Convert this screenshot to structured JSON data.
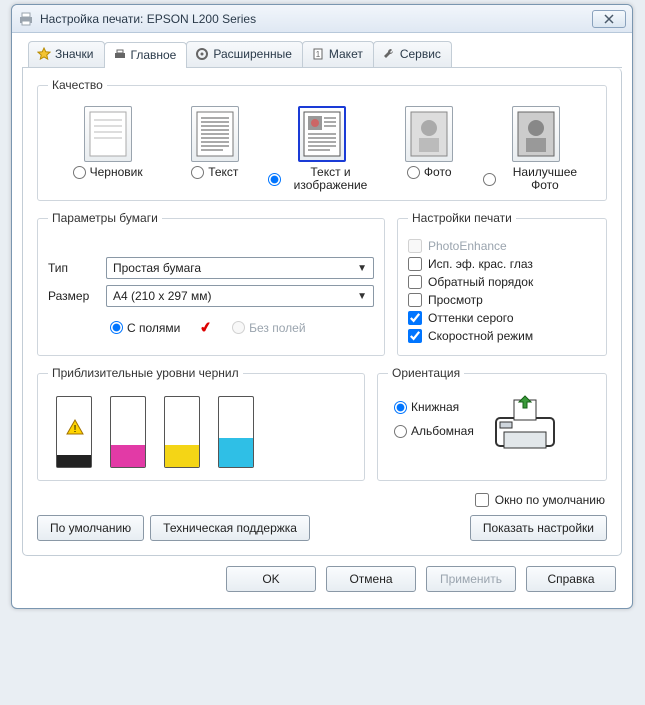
{
  "window": {
    "title": "Настройка печати: EPSON L200 Series"
  },
  "tabs": {
    "items": [
      {
        "label": "Значки"
      },
      {
        "label": "Главное"
      },
      {
        "label": "Расширенные"
      },
      {
        "label": "Макет"
      },
      {
        "label": "Сервис"
      }
    ],
    "active_index": 1
  },
  "quality": {
    "legend": "Качество",
    "options": [
      {
        "label": "Черновик"
      },
      {
        "label": "Текст"
      },
      {
        "label": "Текст и изображение"
      },
      {
        "label": "Фото"
      },
      {
        "label": "Наилучшее Фото"
      }
    ],
    "selected_index": 2
  },
  "paper": {
    "legend": "Параметры бумаги",
    "type_label": "Тип",
    "type_value": "Простая бумага",
    "size_label": "Размер",
    "size_value": "A4 (210 x 297 мм)",
    "borders": {
      "with_label": "С полями",
      "without_label": "Без полей",
      "selected": "with"
    }
  },
  "print_settings": {
    "legend": "Настройки печати",
    "items": [
      {
        "label": "PhotoEnhance",
        "checked": false,
        "enabled": false
      },
      {
        "label": "Исп. эф. крас. глаз",
        "checked": false,
        "enabled": true
      },
      {
        "label": "Обратный порядок",
        "checked": false,
        "enabled": true
      },
      {
        "label": "Просмотр",
        "checked": false,
        "enabled": true
      },
      {
        "label": "Оттенки серого",
        "checked": true,
        "enabled": true
      },
      {
        "label": "Скоростной режим",
        "checked": true,
        "enabled": true
      }
    ]
  },
  "ink": {
    "legend": "Приблизительные уровни чернил",
    "cartridges": [
      {
        "color": "#222222",
        "level_pct": 18,
        "warning": true
      },
      {
        "color": "#e23aa6",
        "level_pct": 32,
        "warning": false
      },
      {
        "color": "#f4d516",
        "level_pct": 32,
        "warning": false
      },
      {
        "color": "#2fbfe6",
        "level_pct": 42,
        "warning": false
      }
    ]
  },
  "orientation": {
    "legend": "Ориентация",
    "portrait_label": "Книжная",
    "landscape_label": "Альбомная",
    "selected": "portrait"
  },
  "default_window": "Окно по умолчанию",
  "buttons": {
    "defaults": "По умолчанию",
    "support": "Техническая поддержка",
    "show_settings": "Показать настройки",
    "ok": "OK",
    "cancel": "Отмена",
    "apply": "Применить",
    "help": "Справка"
  }
}
